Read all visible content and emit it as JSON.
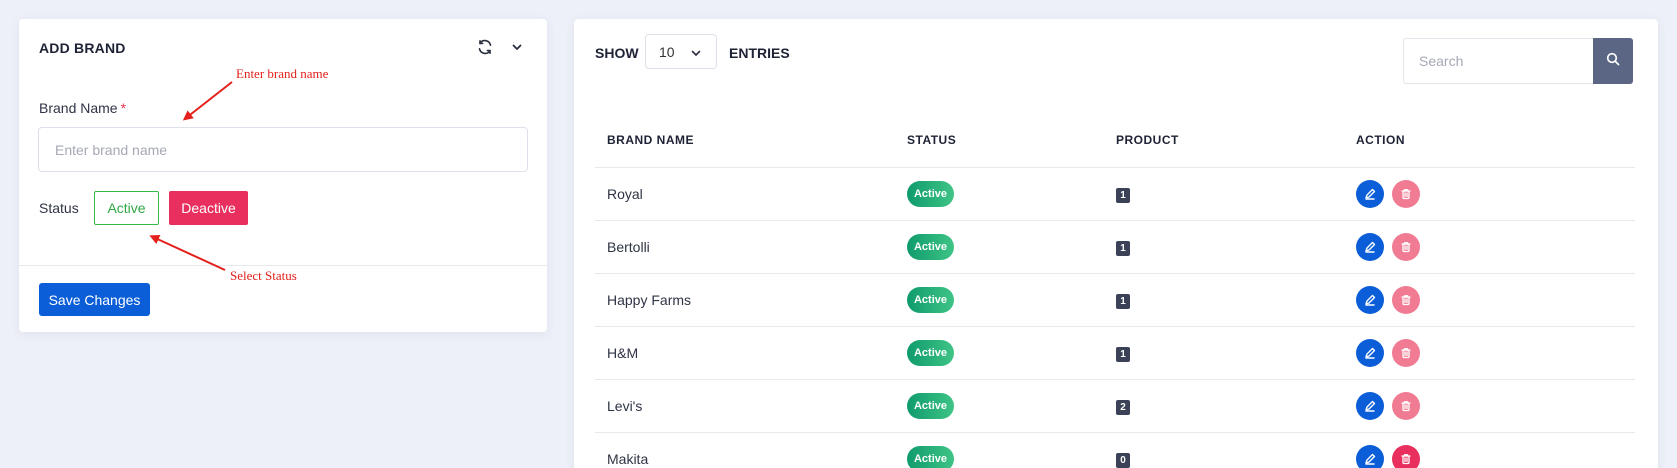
{
  "add_brand": {
    "title": "ADD BRAND",
    "brand_name_label": "Brand Name",
    "required_mark": "*",
    "brand_name_placeholder": "Enter brand name",
    "status_label": "Status",
    "active_label": "Active",
    "deactive_label": "Deactive",
    "save_label": "Save Changes"
  },
  "annotations": {
    "enter_brand_name": "Enter brand name",
    "select_status": "Select Status"
  },
  "list": {
    "show_label": "SHOW",
    "entries_value": "10",
    "entries_label": "ENTRIES",
    "search_placeholder": "Search",
    "columns": [
      "BRAND NAME",
      "STATUS",
      "PRODUCT",
      "ACTION"
    ],
    "rows": [
      {
        "name": "Royal",
        "status": "Active",
        "product": "1"
      },
      {
        "name": "Bertolli",
        "status": "Active",
        "product": "1"
      },
      {
        "name": "Happy Farms",
        "status": "Active",
        "product": "1"
      },
      {
        "name": "H&M",
        "status": "Active",
        "product": "1"
      },
      {
        "name": "Levi's",
        "status": "Active",
        "product": "2"
      },
      {
        "name": "Makita",
        "status": "Active",
        "product": "0"
      }
    ]
  },
  "colors": {
    "primary": "#0b5ed7",
    "danger": "#e92f5d",
    "success": "#2fa844",
    "annotation": "#e3201b"
  }
}
